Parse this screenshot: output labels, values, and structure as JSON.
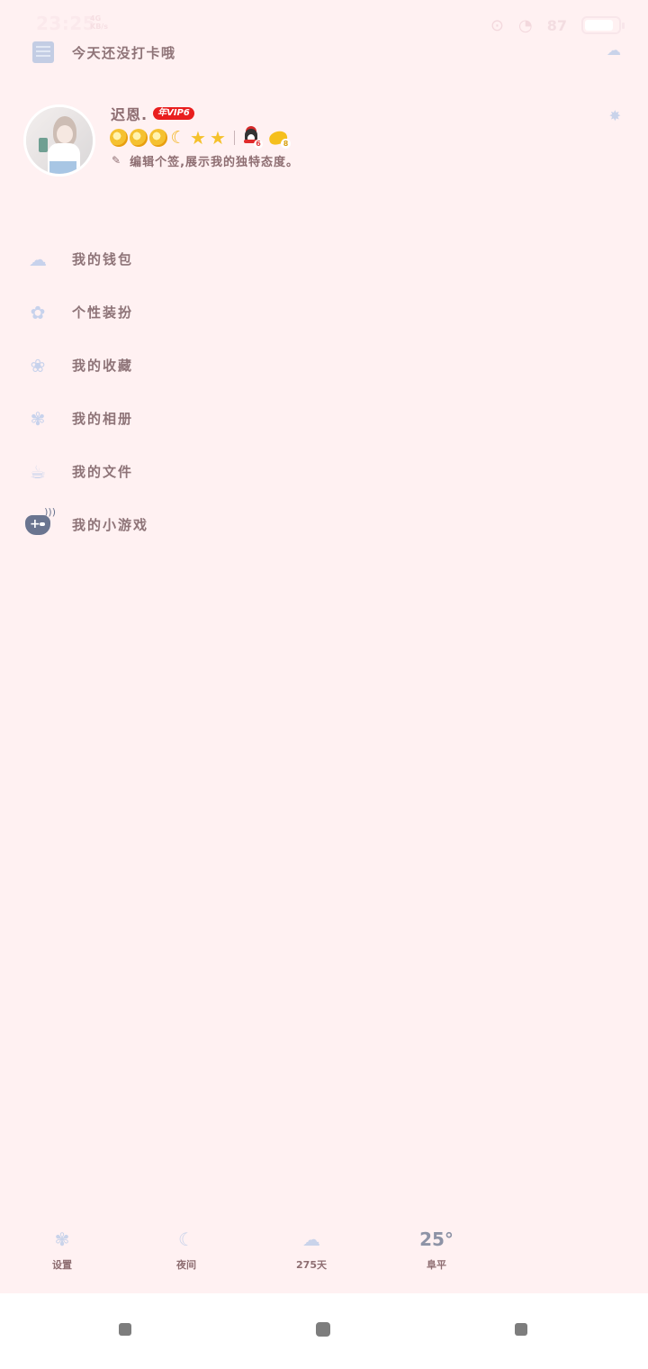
{
  "status_bar": {
    "time": "23:25",
    "net_line1": "4G",
    "net_line2": "KB/s",
    "battery": "87",
    "battery_level": 0.87
  },
  "checkin": {
    "label": "今天还没打卡哦"
  },
  "profile": {
    "nickname": "迟恩.",
    "vip_badge": "年VIP6",
    "qq_badge_num": "6",
    "gold_badge_num": "8",
    "signature": "编辑个签,展示我的独特态度。"
  },
  "menu": [
    {
      "label": "我的钱包",
      "icon": "wallet-icon"
    },
    {
      "label": "个性装扮",
      "icon": "dress-up-icon"
    },
    {
      "label": "我的收藏",
      "icon": "favorites-icon"
    },
    {
      "label": "我的相册",
      "icon": "album-icon"
    },
    {
      "label": "我的文件",
      "icon": "files-icon"
    },
    {
      "label": "我的小游戏",
      "icon": "gamepad-icon"
    }
  ],
  "toolbar": {
    "settings": "设置",
    "night": "夜间",
    "days": "275天",
    "temperature": "25°",
    "city": "阜平"
  },
  "colors": {
    "background": "#fff1f2",
    "text": "#8e6e72",
    "icon": "#c7d2ec",
    "vip": "#e91e1e"
  }
}
